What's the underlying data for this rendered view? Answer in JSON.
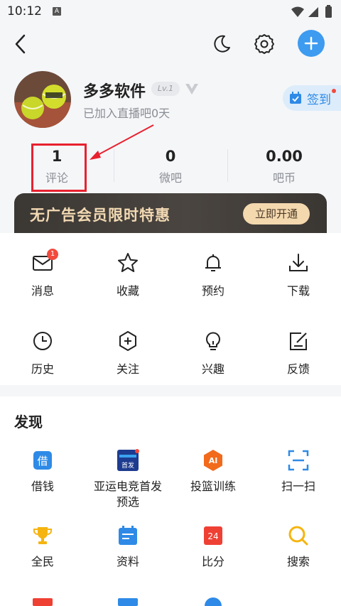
{
  "status_bar": {
    "time": "10:12",
    "notification_letter": "A"
  },
  "user": {
    "name": "多多软件",
    "level": "Lv.1",
    "joined_text": "已加入直播吧0天",
    "signin_label": "签到"
  },
  "stats": [
    {
      "value": "1",
      "label": "评论"
    },
    {
      "value": "0",
      "label": "微吧"
    },
    {
      "value": "0.00",
      "label": "吧币"
    }
  ],
  "vip_banner": {
    "title": "无广告会员限时特惠",
    "button": "立即开通"
  },
  "menu": [
    {
      "label": "消息",
      "icon": "mail-icon",
      "badge": "1"
    },
    {
      "label": "收藏",
      "icon": "star-icon"
    },
    {
      "label": "预约",
      "icon": "bell-icon"
    },
    {
      "label": "下载",
      "icon": "download-icon"
    },
    {
      "label": "历史",
      "icon": "clock-icon"
    },
    {
      "label": "关注",
      "icon": "hexagon-plus-icon"
    },
    {
      "label": "兴趣",
      "icon": "lightbulb-icon"
    },
    {
      "label": "反馈",
      "icon": "edit-icon"
    }
  ],
  "discover": {
    "title": "发现",
    "items": [
      {
        "label": "借钱",
        "icon": "loan-icon",
        "icon_text": "借"
      },
      {
        "label": "亚运电竞首发预选",
        "icon": "esports-icon",
        "icon_text": "首发"
      },
      {
        "label": "投篮训练",
        "icon": "ai-shoot-icon",
        "icon_text": "AI"
      },
      {
        "label": "扫一扫",
        "icon": "scan-icon"
      },
      {
        "label": "全民",
        "icon": "trophy-icon"
      },
      {
        "label": "资料",
        "icon": "calendar-icon"
      },
      {
        "label": "比分",
        "icon": "score-icon",
        "icon_text": "24"
      },
      {
        "label": "搜索",
        "icon": "search-icon"
      }
    ]
  },
  "colors": {
    "accent": "#3d9bf0",
    "highlight": "#e8212f",
    "vip_gold": "#f2d9b3"
  }
}
